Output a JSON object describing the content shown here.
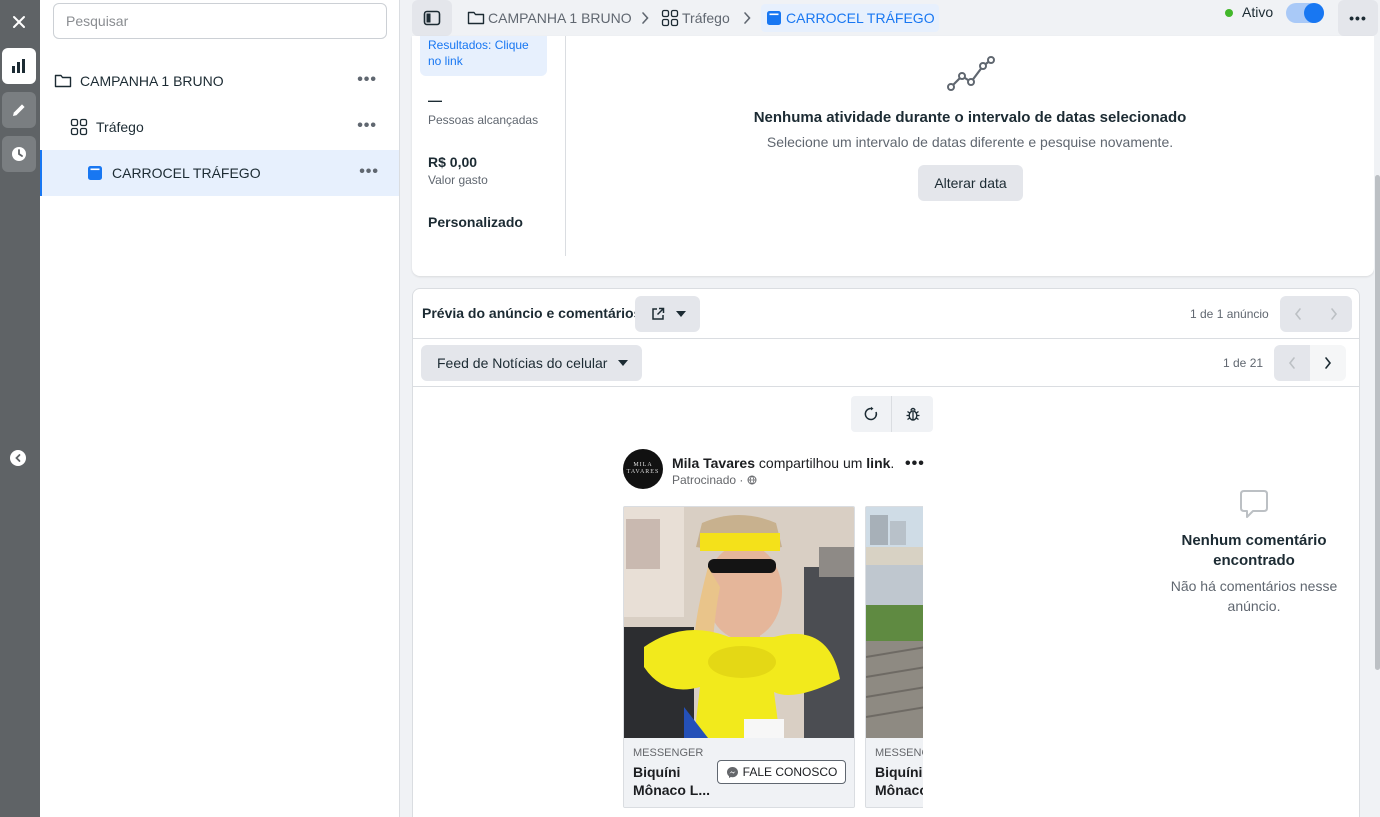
{
  "rail": {
    "icons": [
      "close-icon",
      "chart-icon",
      "pencil-icon",
      "clock-icon",
      "chevron-left-icon"
    ]
  },
  "sidebar": {
    "search_placeholder": "Pesquisar",
    "items": [
      {
        "label": "CAMPANHA 1 BRUNO",
        "icon": "folder-icon"
      },
      {
        "label": "Tráfego",
        "icon": "grid-icon"
      },
      {
        "label": "CARROCEL TRÁFEGO",
        "icon": "ad-icon"
      }
    ]
  },
  "breadcrumb": {
    "items": [
      {
        "label": "CAMPANHA 1 BRUNO",
        "icon": "folder-icon"
      },
      {
        "label": "Tráfego",
        "icon": "grid-icon"
      },
      {
        "label": "CARROCEL TRÁFEGO",
        "icon": "ad-icon"
      }
    ]
  },
  "status": {
    "label": "Ativo",
    "on": true,
    "dot_color": "#42b72a"
  },
  "performance": {
    "result_label": "Resultados: Clique no link",
    "reach_value": "—",
    "reach_label": "Pessoas alcançadas",
    "spend_value": "R$ 0,00",
    "spend_label": "Valor gasto",
    "custom_label": "Personalizado",
    "empty_title": "Nenhuma atividade durante o intervalo de datas selecionado",
    "empty_subtitle": "Selecione um intervalo de datas diferente e pesquise novamente.",
    "change_date_button": "Alterar data"
  },
  "preview": {
    "title": "Prévia do anúncio e comentários",
    "ad_count": "1 de 1 anúncio",
    "placement": "Feed de Notícias do celular",
    "placement_count": "1 de 21",
    "ad": {
      "avatar_text": "MILA TAVARES",
      "page_name": "Mila Tavares",
      "shared_text": "compartilhou um",
      "link_word": "link",
      "period": ".",
      "sponsored": "Patrocinado ·",
      "cards": [
        {
          "channel": "MESSENGER",
          "title": "Biquíni Mônaco L...",
          "cta": "FALE CONOSCO"
        },
        {
          "channel": "MESSENG",
          "title": "Biquíni Mônaco"
        }
      ]
    },
    "comments": {
      "title": "Nenhum comentário encontrado",
      "subtitle": "Não há comentários nesse anúncio."
    }
  },
  "colors": {
    "accent": "#1877f2",
    "rail": "#5f6366"
  }
}
